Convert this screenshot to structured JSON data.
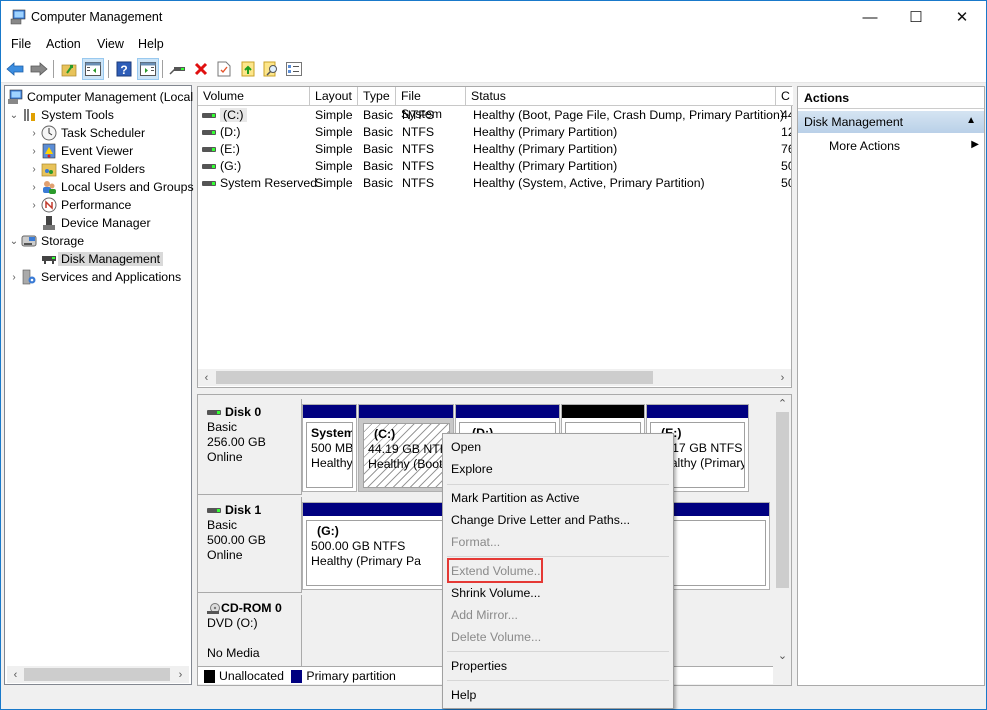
{
  "window": {
    "title": "Computer Management",
    "controls": {
      "minimize": "—",
      "maximize": "☐",
      "close": "✕"
    }
  },
  "menubar": [
    "File",
    "Action",
    "View",
    "Help"
  ],
  "toolbar": {
    "buttons": [
      "back-icon",
      "forward-icon",
      "up-folder-icon",
      "show-hide-tree-icon",
      "help-icon",
      "show-hide-action-pane-icon",
      "connect-drive-icon",
      "delete-icon",
      "properties-check-icon",
      "export-icon",
      "search-icon",
      "settings-list-icon"
    ]
  },
  "tree": {
    "root": "Computer Management (Local",
    "items": [
      {
        "label": "System Tools",
        "level": 1,
        "expanded": true
      },
      {
        "label": "Task Scheduler",
        "level": 2
      },
      {
        "label": "Event Viewer",
        "level": 2
      },
      {
        "label": "Shared Folders",
        "level": 2
      },
      {
        "label": "Local Users and Groups",
        "level": 2
      },
      {
        "label": "Performance",
        "level": 2
      },
      {
        "label": "Device Manager",
        "level": 2
      },
      {
        "label": "Storage",
        "level": 1,
        "expanded": true
      },
      {
        "label": "Disk Management",
        "level": 2,
        "selected": true
      },
      {
        "label": "Services and Applications",
        "level": 1
      }
    ]
  },
  "volume_list": {
    "columns": [
      "Volume",
      "Layout",
      "Type",
      "File System",
      "Status",
      "C"
    ],
    "rows": [
      {
        "volume": "(C:)",
        "layout": "Simple",
        "type": "Basic",
        "fs": "NTFS",
        "status": "Healthy (Boot, Page File, Crash Dump, Primary Partition)",
        "cap": "44"
      },
      {
        "volume": "(D:)",
        "layout": "Simple",
        "type": "Basic",
        "fs": "NTFS",
        "status": "Healthy (Primary Partition)",
        "cap": "12"
      },
      {
        "volume": "(E:)",
        "layout": "Simple",
        "type": "Basic",
        "fs": "NTFS",
        "status": "Healthy (Primary Partition)",
        "cap": "76"
      },
      {
        "volume": "(G:)",
        "layout": "Simple",
        "type": "Basic",
        "fs": "NTFS",
        "status": "Healthy (Primary Partition)",
        "cap": "50"
      },
      {
        "volume": "System Reserved",
        "layout": "Simple",
        "type": "Basic",
        "fs": "NTFS",
        "status": "Healthy (System, Active, Primary Partition)",
        "cap": "50"
      }
    ]
  },
  "disks": [
    {
      "name": "Disk 0",
      "type": "Basic",
      "size": "256.00 GB",
      "state": "Online",
      "partitions": [
        {
          "name": "System",
          "size": "500 MB",
          "status": "Healthy"
        },
        {
          "name": "(C:)",
          "size": "44.19 GB NTFS",
          "status": "Healthy (Boot"
        },
        {
          "name": "(D:)",
          "size": "",
          "status": ""
        },
        {
          "name": "",
          "size": "",
          "status": ""
        },
        {
          "name": "(E:)",
          "size": "76.17 GB NTFS",
          "status": "Healthy (Primary"
        }
      ]
    },
    {
      "name": "Disk 1",
      "type": "Basic",
      "size": "500.00 GB",
      "state": "Online",
      "partitions": [
        {
          "name": "(G:)",
          "size": "500.00 GB NTFS",
          "status": "Healthy (Primary Pa"
        }
      ]
    },
    {
      "name": "CD-ROM 0",
      "type": "DVD (O:)",
      "size": "",
      "state": "No Media"
    }
  ],
  "legend": {
    "unallocated": "Unallocated",
    "primary": "Primary partition",
    "unallocated_color": "#000000",
    "primary_color": "#000080"
  },
  "actions": {
    "header": "Actions",
    "section": "Disk Management",
    "items": [
      "More Actions"
    ]
  },
  "context_menu": {
    "items": [
      {
        "label": "Open",
        "enabled": true
      },
      {
        "label": "Explore",
        "enabled": true
      },
      {
        "label": "Mark Partition as Active",
        "enabled": true
      },
      {
        "label": "Change Drive Letter and Paths...",
        "enabled": true
      },
      {
        "label": "Format...",
        "enabled": false
      },
      {
        "label": "Extend Volume...",
        "enabled": false,
        "highlighted": true
      },
      {
        "label": "Shrink Volume...",
        "enabled": true
      },
      {
        "label": "Add Mirror...",
        "enabled": false
      },
      {
        "label": "Delete Volume...",
        "enabled": false
      },
      {
        "label": "Properties",
        "enabled": true
      },
      {
        "label": "Help",
        "enabled": true
      }
    ],
    "highlight_color": "#e53935"
  }
}
